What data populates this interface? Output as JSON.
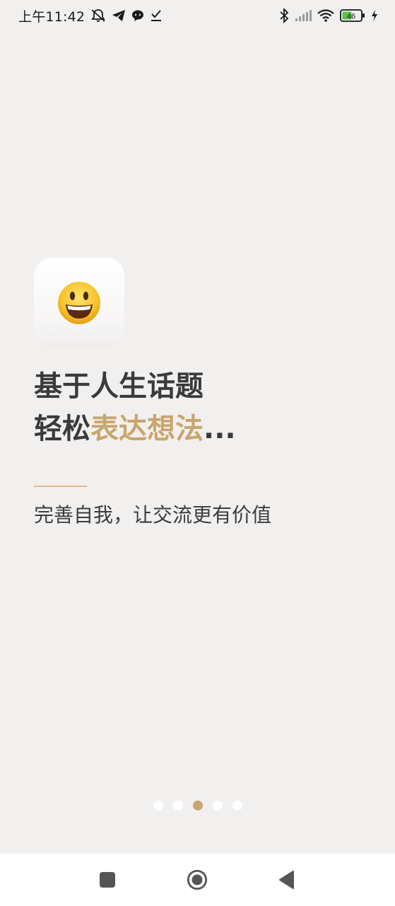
{
  "status_bar": {
    "time": "上午11:42",
    "battery_level": "46",
    "icons": [
      "mute-bell-icon",
      "telegram-icon",
      "chat-bubble-icon",
      "download-check-icon",
      "bluetooth-icon",
      "cellular-signal-icon",
      "wifi-icon",
      "battery-icon",
      "charging-icon"
    ]
  },
  "onboarding": {
    "app_icon": "smiley-emoji-icon",
    "headline_line1": "基于人生话题",
    "headline_line2_plain": "轻松",
    "headline_line2_accent": "表达想法",
    "headline_line2_suffix": "...",
    "subtitle": "完善自我，让交流更有价值",
    "accent_color": "#c9a66e",
    "divider_color": "#e2b98a"
  },
  "pager": {
    "total_pages": 5,
    "current_page": 3
  },
  "nav_bar": {
    "buttons": [
      "recent-apps-icon",
      "home-icon",
      "back-icon"
    ]
  }
}
